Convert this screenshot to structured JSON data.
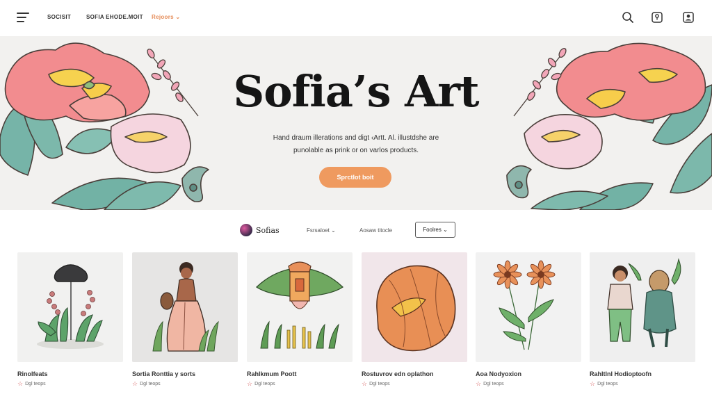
{
  "nav": {
    "links": [
      "SOCISIT",
      "SOFIA EHODE.MOIT",
      "Rejoors"
    ],
    "icons": [
      "search-icon",
      "bag-icon",
      "account-icon"
    ],
    "accent": "#e58a55"
  },
  "hero": {
    "title": "Sofia’s Art",
    "subtitle_line1": "Hand draum illerations and digt ‹Artt. Al. illustdshe are",
    "subtitle_line2": "punolable as prink or on varlos products.",
    "cta_label": "Sprctlot boit",
    "cta_color": "#ef9a5f"
  },
  "filters": {
    "artist": "Sofias",
    "dropdown1": "Fsrsaloet",
    "dropdown2": "Aosaw titocle",
    "button": "Foolres"
  },
  "cards": [
    {
      "title": "Rinolfeats",
      "meta": "Dgl teops",
      "bg": "#f1f1f0"
    },
    {
      "title": "Sortia Ronttia y sorts",
      "meta": "Dgl teops",
      "bg": "#e6e5e4"
    },
    {
      "title": "Rahlkmum Poott",
      "meta": "Dgl teops",
      "bg": "#f2f2f1"
    },
    {
      "title": "Rostuvrov edn oplathon",
      "meta": "Dgl teops",
      "bg": "#f1e6ea"
    },
    {
      "title": "Aoa Nodyoxion",
      "meta": "Dgl teops",
      "bg": "#f2f2f2"
    },
    {
      "title": "Rahltlnl Hodioptoofn",
      "meta": "Dgl teops",
      "bg": "#efefef"
    }
  ]
}
